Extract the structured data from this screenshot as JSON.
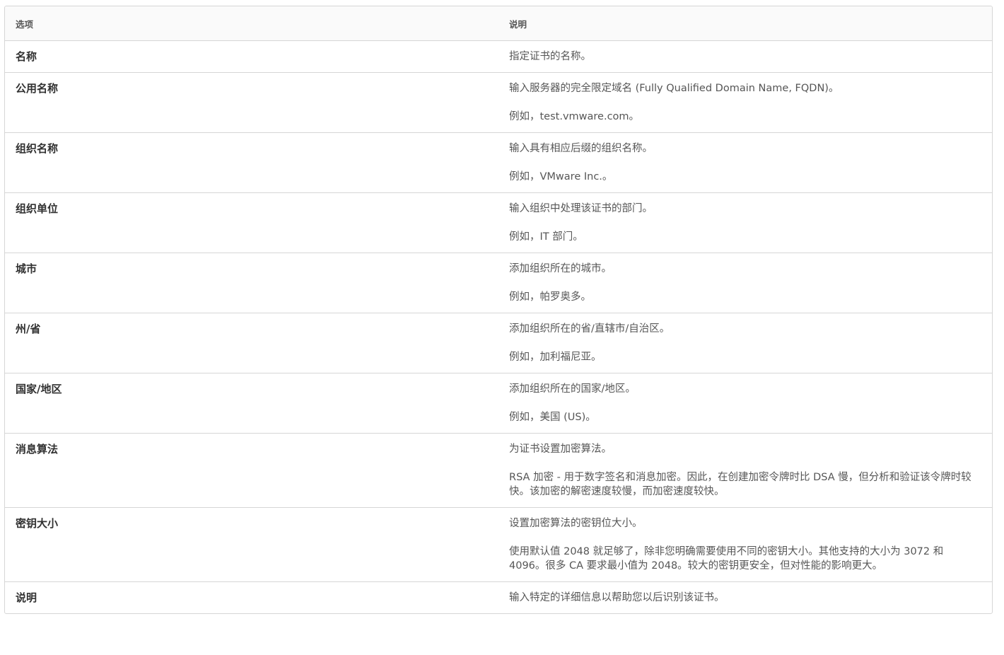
{
  "table": {
    "headers": {
      "option": "选项",
      "description": "说明"
    },
    "rows": [
      {
        "option": "名称",
        "desc": [
          "指定证书的名称。"
        ]
      },
      {
        "option": "公用名称",
        "desc": [
          "输入服务器的完全限定域名 (Fully Qualified Domain Name, FQDN)。",
          "例如，test.vmware.com。"
        ]
      },
      {
        "option": "组织名称",
        "desc": [
          "输入具有相应后缀的组织名称。",
          "例如，VMware Inc.。"
        ]
      },
      {
        "option": "组织单位",
        "desc": [
          "输入组织中处理该证书的部门。",
          "例如，IT 部门。"
        ]
      },
      {
        "option": "城市",
        "desc": [
          "添加组织所在的城市。",
          "例如，帕罗奥多。"
        ]
      },
      {
        "option": "州/省",
        "desc": [
          "添加组织所在的省/直辖市/自治区。",
          "例如，加利福尼亚。"
        ]
      },
      {
        "option": "国家/地区",
        "desc": [
          "添加组织所在的国家/地区。",
          "例如，美国 (US)。"
        ]
      },
      {
        "option": "消息算法",
        "desc": [
          "为证书设置加密算法。",
          "RSA 加密 - 用于数字签名和消息加密。因此，在创建加密令牌时比 DSA 慢，但分析和验证该令牌时较快。该加密的解密速度较慢，而加密速度较快。"
        ]
      },
      {
        "option": "密钥大小",
        "desc": [
          "设置加密算法的密钥位大小。",
          "使用默认值 2048 就足够了，除非您明确需要使用不同的密钥大小。其他支持的大小为 3072 和 4096。很多 CA 要求最小值为 2048。较大的密钥更安全，但对性能的影响更大。"
        ]
      },
      {
        "option": "说明",
        "desc": [
          "输入特定的详细信息以帮助您以后识别该证书。"
        ]
      }
    ]
  }
}
